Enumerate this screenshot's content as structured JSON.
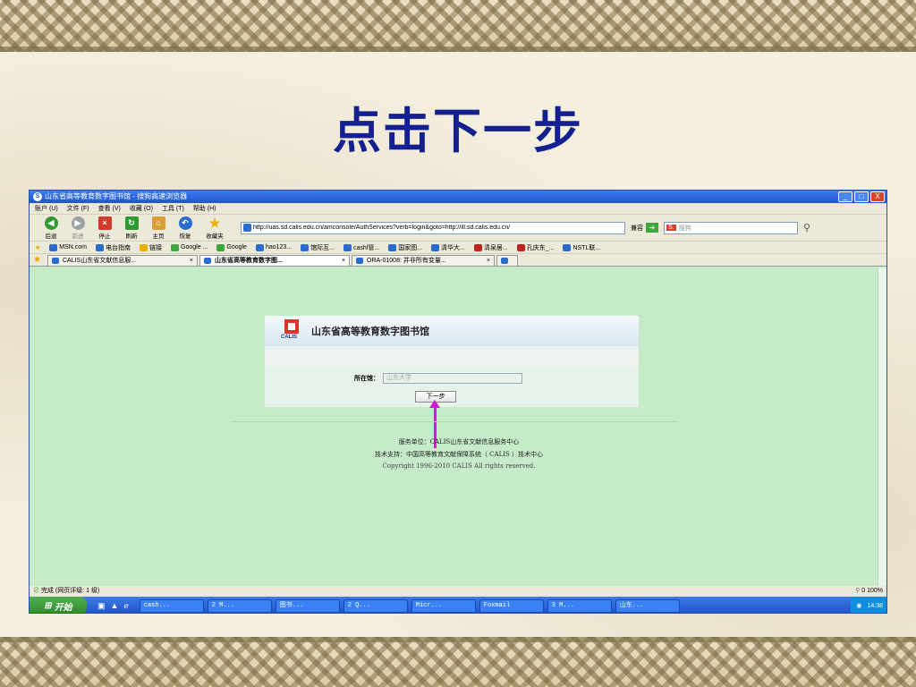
{
  "slide": {
    "title": "点击下一步"
  },
  "window": {
    "title": "山东省高等教育数字图书馆 - 搜狗高速浏览器",
    "controls": [
      "_",
      "□",
      "X"
    ]
  },
  "menu": [
    "账户 (U)",
    "文件 (F)",
    "查看 (V)",
    "收藏 (O)",
    "工具 (T)",
    "帮助 (H)"
  ],
  "toolbar": {
    "back": "后退",
    "forward": "前进",
    "stop": "停止",
    "refresh": "刷新",
    "home": "主页",
    "restore": "恢复",
    "favorites": "收藏夹"
  },
  "address": {
    "url": "http://uas.sd.calis.edu.cn/amconsole/AuthServices?verb=login&goto=http://ill.sd.calis.edu.cn/",
    "compat": "兼容"
  },
  "search": {
    "placeholder": "搜狗",
    "logo": "S."
  },
  "favorites_bar": [
    "MSN.com",
    "电台指南",
    "链接",
    "Google ...",
    "Google",
    "hao123...",
    "馆际互...",
    "cashl管...",
    "国家图...",
    "清华大...",
    "清泉居...",
    "孔庆东_...",
    "NSTL联..."
  ],
  "tabs": [
    {
      "label": "CALIS山东省文献信息服...",
      "close": "×"
    },
    {
      "label": "山东省高等教育数字图...",
      "close": "×"
    },
    {
      "label": "ORA-01008: 并非所有变量...",
      "close": "×"
    }
  ],
  "page": {
    "logo_text": "CALIS",
    "library_name": "山东省高等教育数字图书馆",
    "field_label": "所在馆：",
    "field_value": "山东大学",
    "next_button": "下一步",
    "footer": [
      "服务单位：CALIS山东省文献信息服务中心",
      "技术支持：中国高等教育文献保障系统（ CALIS ）技术中心",
      "Copyright 1996-2010 CALIS All rights reserved."
    ]
  },
  "statusbar": {
    "left": "完成 (网页评级: 1 级)",
    "zoom": "0",
    "zoom_pct": "100%"
  },
  "taskbar": {
    "start": "开始",
    "tasks": [
      "cash...",
      "2 M...",
      "图书...",
      "2 Q...",
      "Micr...",
      "Foxmail",
      "3 M...",
      "山东..."
    ],
    "clock": "14:38"
  },
  "colors": {
    "title": "#14208f",
    "page_bg": "#c5ebc9",
    "arrow": "#d31bd6"
  }
}
